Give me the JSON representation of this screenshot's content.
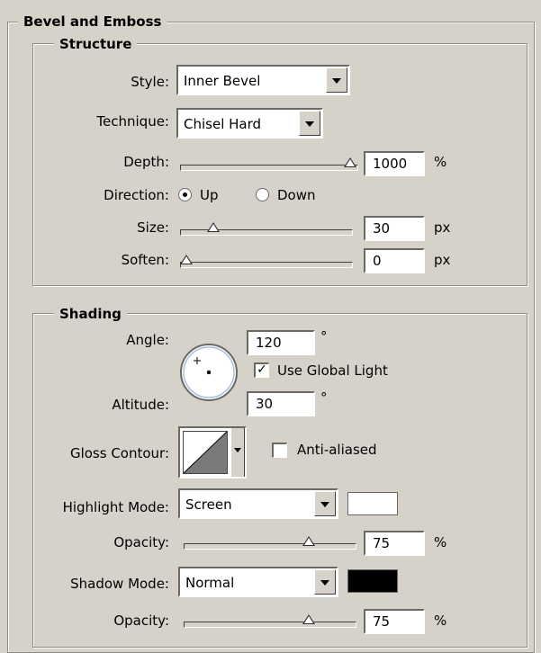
{
  "panel_title": "Bevel and Emboss",
  "structure": {
    "title": "Structure",
    "style": {
      "label": "Style:",
      "value": "Inner Bevel"
    },
    "technique": {
      "label": "Technique:",
      "value": "Chisel Hard"
    },
    "depth": {
      "label": "Depth:",
      "value": "1000",
      "unit": "%",
      "slider_fraction": 1.0
    },
    "direction": {
      "label": "Direction:",
      "up": "Up",
      "down": "Down",
      "selected": "Up"
    },
    "size": {
      "label": "Size:",
      "value": "30",
      "unit": "px",
      "slider_fraction": 0.17
    },
    "soften": {
      "label": "Soften:",
      "value": "0",
      "unit": "px",
      "slider_fraction": 0.0
    }
  },
  "shading": {
    "title": "Shading",
    "angle": {
      "label": "Angle:",
      "value": "120",
      "unit": "°"
    },
    "use_global_light": {
      "label": "Use Global Light",
      "checked": true,
      "mark": "✓"
    },
    "altitude": {
      "label": "Altitude:",
      "value": "30",
      "unit": "°"
    },
    "gloss_contour": {
      "label": "Gloss Contour:"
    },
    "anti_aliased": {
      "label": "Anti-aliased",
      "checked": false
    },
    "highlight_mode": {
      "label": "Highlight Mode:",
      "value": "Screen",
      "color": "#ffffff"
    },
    "highlight_opacity": {
      "label": "Opacity:",
      "value": "75",
      "unit": "%",
      "slider_fraction": 0.75
    },
    "shadow_mode": {
      "label": "Shadow Mode:",
      "value": "Normal",
      "color": "#000000"
    },
    "shadow_opacity": {
      "label": "Opacity:",
      "value": "75",
      "unit": "%",
      "slider_fraction": 0.75
    }
  }
}
